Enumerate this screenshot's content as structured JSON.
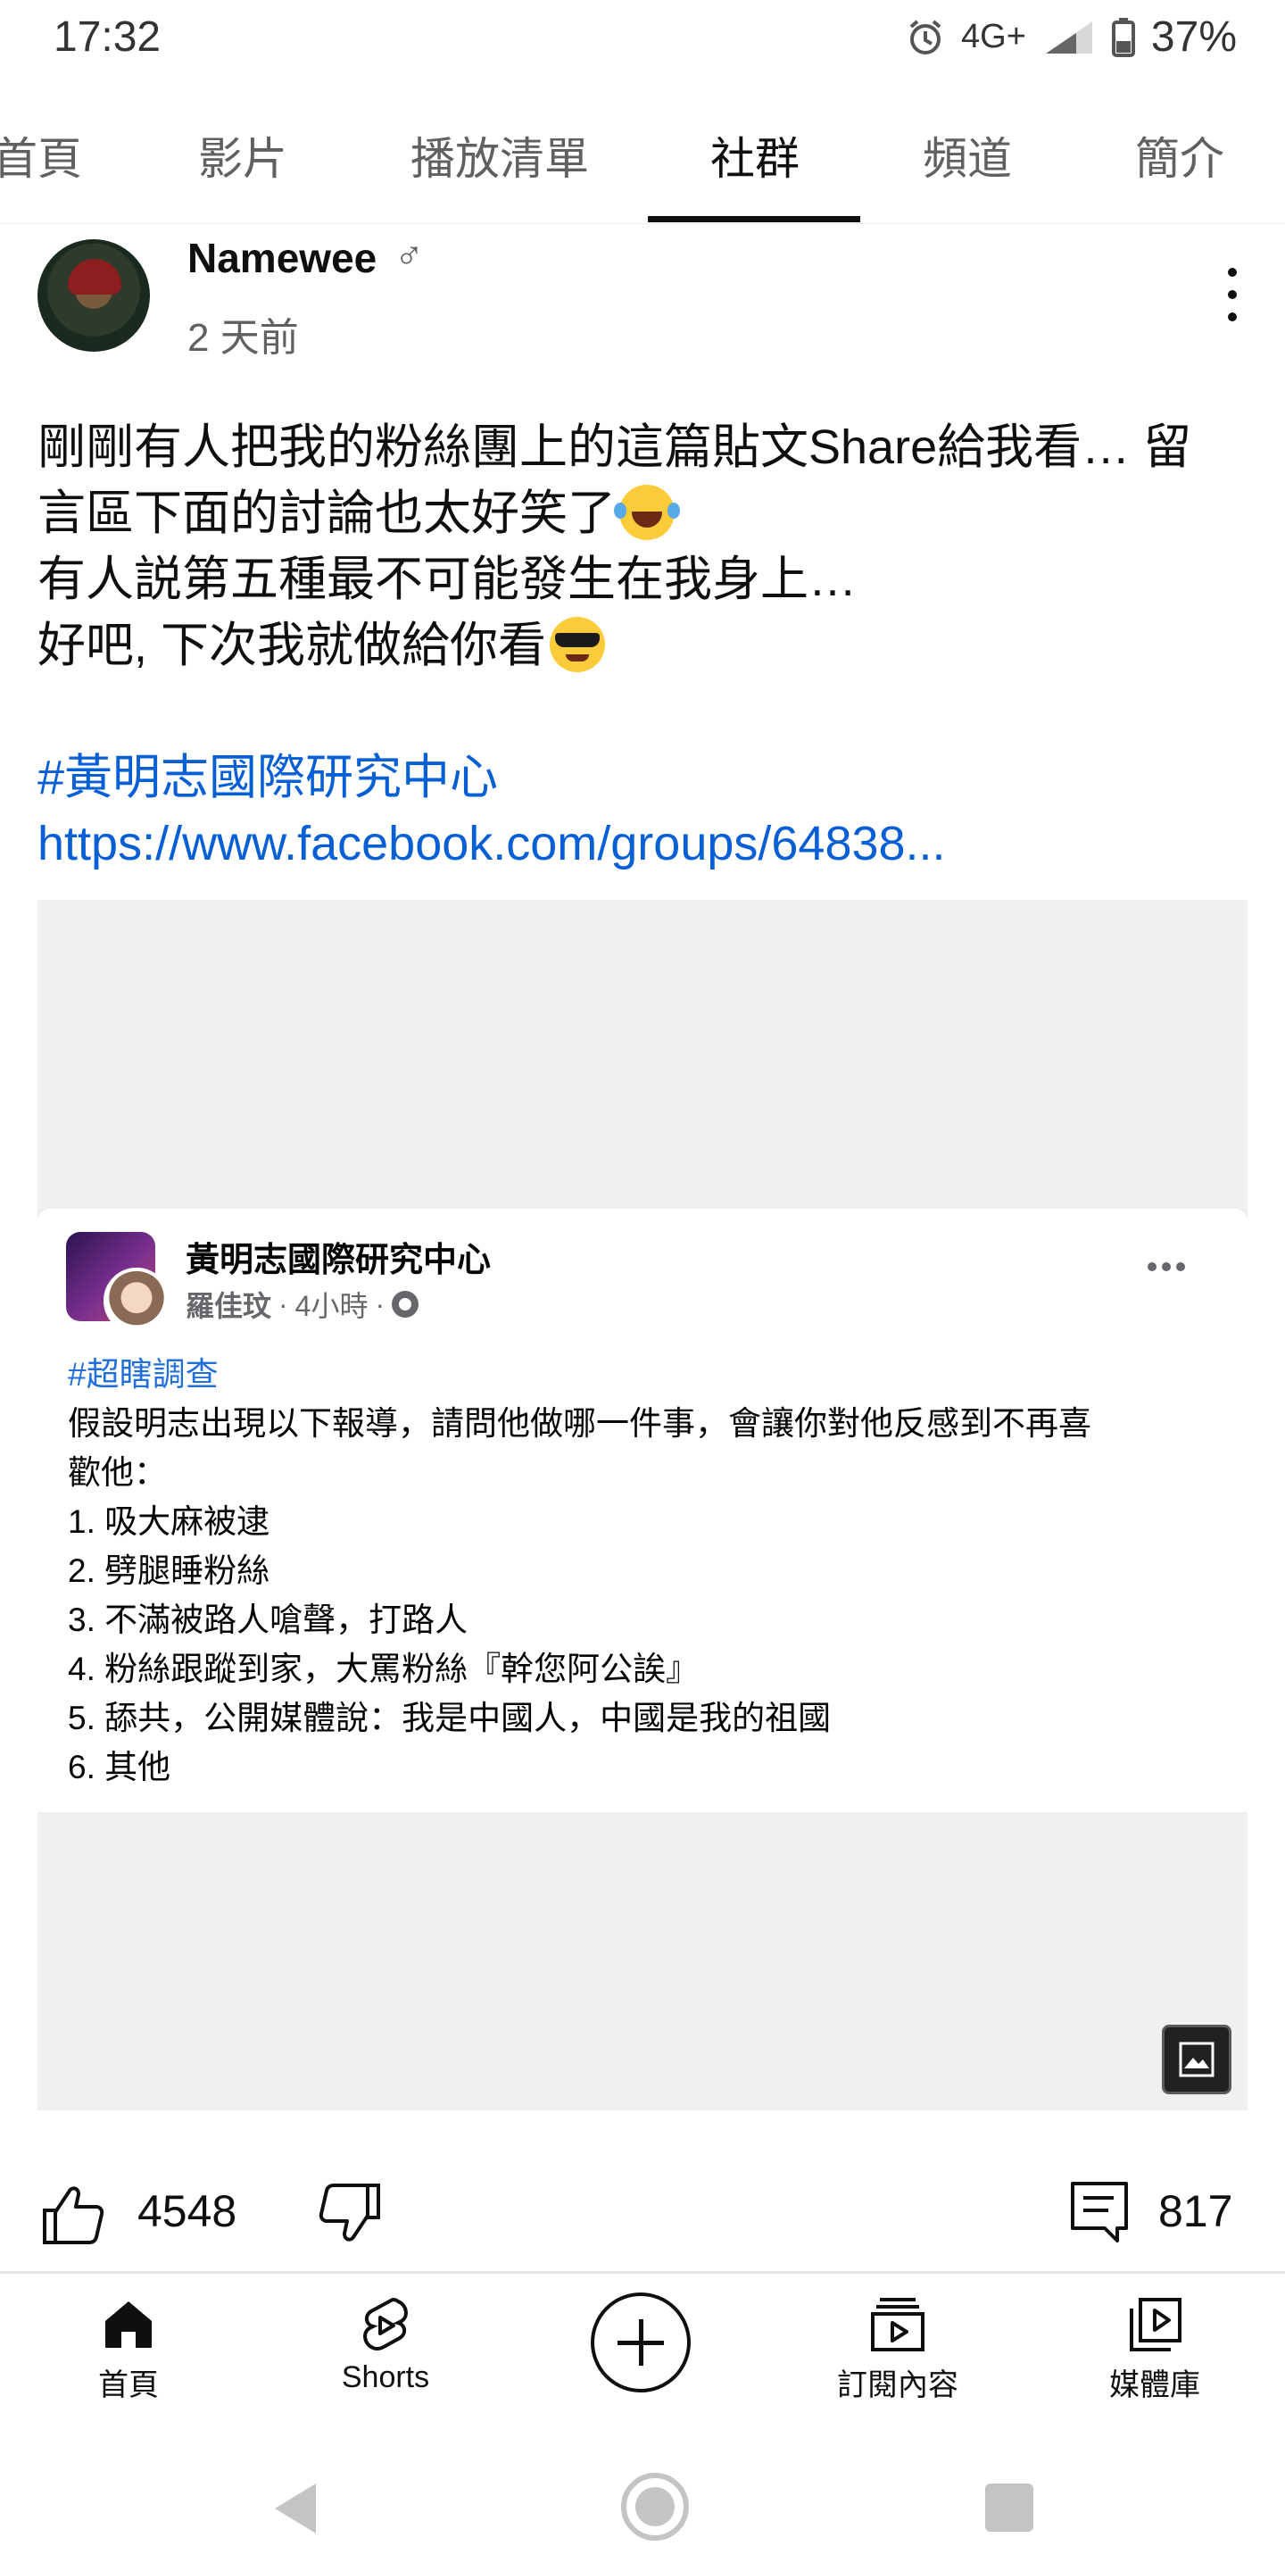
{
  "status_bar": {
    "time": "17:32",
    "network": "4G+",
    "battery": "37%",
    "icons": [
      "alarm-icon",
      "signal-icon",
      "battery-icon"
    ]
  },
  "tabs": [
    "首頁",
    "影片",
    "播放清單",
    "社群",
    "頻道",
    "簡介"
  ],
  "active_tab": "社群",
  "post": {
    "author": "Namewee",
    "author_badge": "♂",
    "time": "2 天前",
    "body_lines": [
      "剛剛有人把我的粉絲團上的這篇貼文Share給我看… 留",
      "言區下面的討論也太好笑了",
      "有人説第五種最不可能發生在我身上…",
      "好吧, 下次我就做給你看"
    ],
    "hashtag": "#黃明志國際研究中心",
    "link": "https://www.facebook.com/groups/64838..."
  },
  "shared_image": {
    "group_name": "黃明志國際研究中心",
    "poster": "羅佳玟",
    "time": "4小時",
    "tag": "#超瞎調查",
    "intro_lines": [
      "假設明志出現以下報導，請問他做哪一件事，會讓你對他反感到不再喜",
      "歡他："
    ],
    "options": [
      "1. 吸大麻被逮",
      "2. 劈腿睡粉絲",
      "3. 不滿被路人嗆聲，打路人",
      "4. 粉絲跟蹤到家，大罵粉絲『幹您阿公誒』",
      "5. 舔共，公開媒體說：我是中國人，中國是我的祖國",
      "6. 其他"
    ]
  },
  "actions": {
    "likes": "4548",
    "comments": "817"
  },
  "bottom_nav": [
    {
      "label": "首頁",
      "icon": "home-icon"
    },
    {
      "label": "Shorts",
      "icon": "shorts-icon"
    },
    {
      "label": "",
      "icon": "create-icon"
    },
    {
      "label": "訂閱內容",
      "icon": "subscriptions-icon"
    },
    {
      "label": "媒體庫",
      "icon": "library-icon"
    }
  ],
  "colors": {
    "link": "#065fd4",
    "fb_tag": "#216fdb",
    "secondary_text": "#606060"
  }
}
